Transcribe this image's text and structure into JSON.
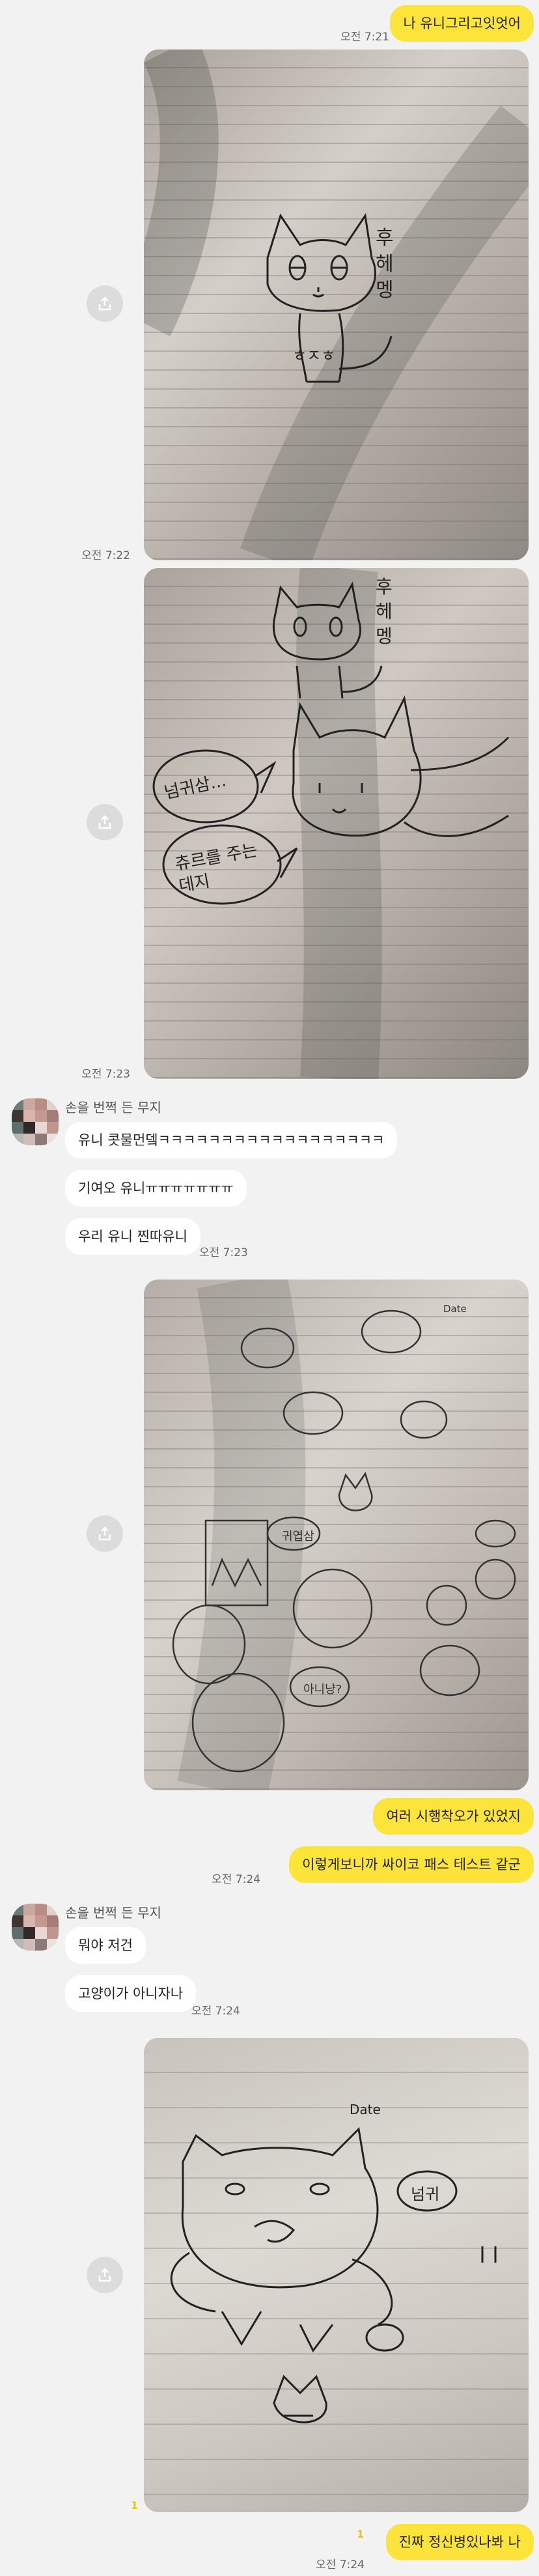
{
  "messages": {
    "m1_text": "나 유니그리고잇엇어",
    "m1_time": "오전 7:21",
    "photo1_time": "오전 7:22",
    "photo2_time": "오전 7:23",
    "sender_name_1": "손을 번쩍 든 무지",
    "in1": "유니 콧물먼뎈ㅋㅋㅋㅋㅋㅋㅋㅋㅋㅋㅋㅋㅋㅋㅋㅋㅋㅋ",
    "in2": "기여오 유니ㅠㅠㅠㅠㅠㅠㅠ",
    "in3": "우리 유니 찐따유니",
    "in3_time": "오전 7:23",
    "out2": "여러 시행착오가 있었지",
    "out3": "이렇게보니까 싸이코 패스 테스트 같군",
    "out3_time": "오전 7:24",
    "sender_name_2": "손을 번쩍 든 무지",
    "in4": "뭐야 저건",
    "in5": "고양이가 아니자나",
    "in5_time": "오전 7:24",
    "photo4_unread": "1",
    "out4_unread": "1",
    "out4": "진짜 정신병있나봐 나",
    "out4_time": "오전 7:24"
  },
  "photo1": {
    "handwriting": "후헤멩",
    "belly": "ㅎㅈㅎ"
  },
  "photo2": {
    "speech1": "넘귀삼...",
    "speech2": "츄르를 주는데지",
    "handwriting": "후헤멩"
  },
  "photo3": {
    "speech1": "귀엽삼",
    "speech2": "아니냥?",
    "header": "Date"
  },
  "photo4": {
    "header": "Date",
    "speech": "넘귀"
  },
  "colors": {
    "outgoing_bubble": "#fce43a",
    "incoming_bubble": "#ffffff",
    "background": "#f2f2f2",
    "unread": "#e8c416"
  },
  "icons": {
    "share": "share-icon",
    "avatar": "pixelated-avatar"
  }
}
